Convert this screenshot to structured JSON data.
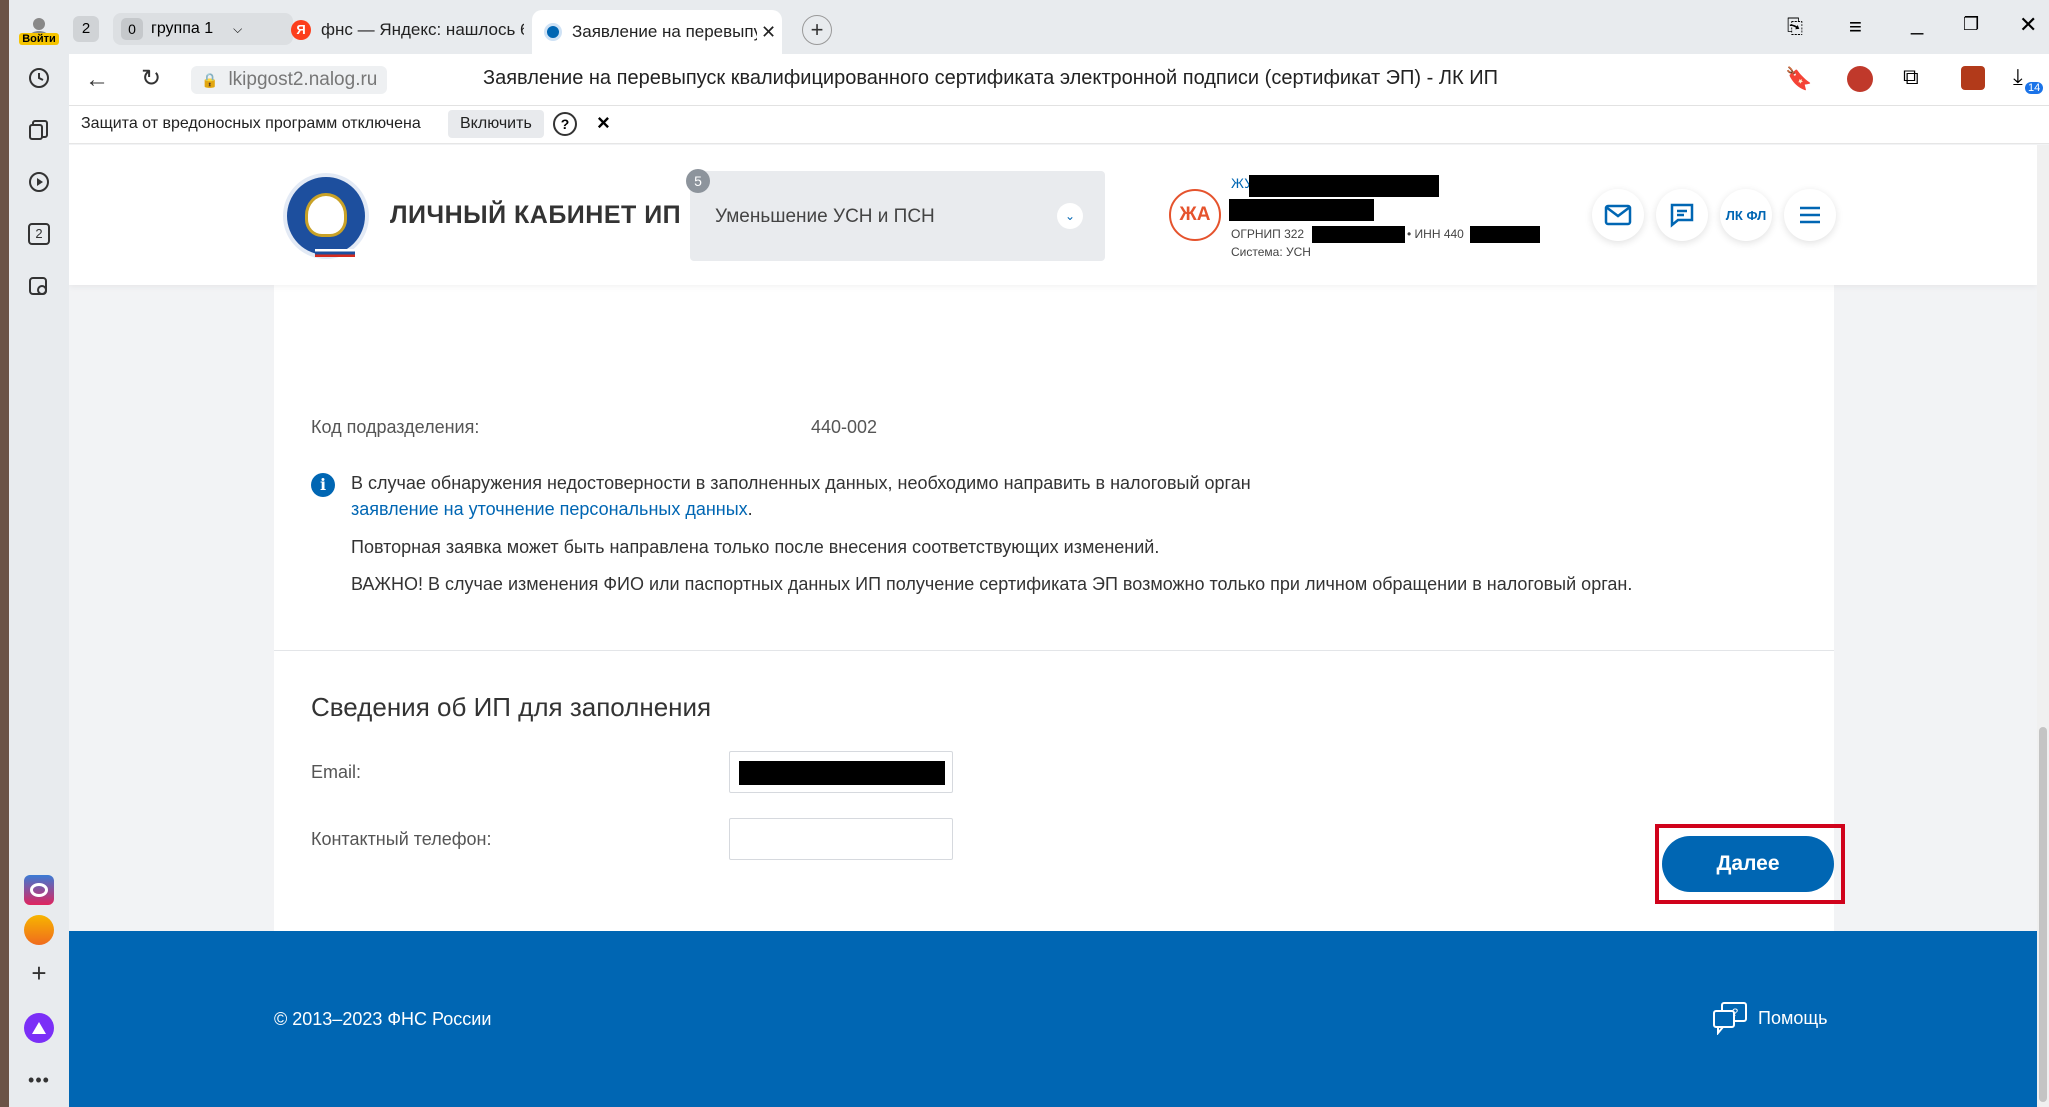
{
  "browser": {
    "login_label": "Войти",
    "tab_count_badge": "2",
    "group_count_badge": "0",
    "group_label": "группа 1",
    "tabs": [
      {
        "label": "фнс — Яндекс: нашлось 6"
      },
      {
        "label": "Заявление на перевыпу"
      }
    ],
    "address": "lkipgost2.nalog.ru",
    "page_title": "Заявление на перевыпуск квалифицированного сертификата электронной подписи (сертификат ЭП) - ЛК ИП",
    "downloads_badge": "14",
    "sidebar_badge": "2",
    "infobar": {
      "text": "Защита от вредоносных программ отключена",
      "enable_button": "Включить",
      "help_icon": "?",
      "close_icon": "×"
    }
  },
  "site": {
    "title": "ЛИЧНЫЙ КАБИНЕТ ИП",
    "task_badge": "5",
    "task_select": "Уменьшение УСН и ПСН",
    "user": {
      "initials": "ЖА",
      "name_prefix": "ЖУ",
      "ogrnip_label": "ОГРНИП 322",
      "inn_label": "• ИНН 440",
      "system": "Система: УСН"
    },
    "lk_fl": "ЛК ФЛ"
  },
  "content": {
    "cut_label": "Код подразделения:",
    "cut_value": "440-002",
    "info_text": "В случае обнаружения недостоверности в заполненных данных, необходимо направить в налоговый орган",
    "info_link": "заявление на уточнение персональных данных",
    "info_link_suffix": ".",
    "note1": "Повторная заявка может быть направлена только после внесения соответствующих изменений.",
    "note2": "ВАЖНО! В случае изменения ФИО или паспортных данных ИП получение сертификата ЭП возможно только при личном обращении в налоговый орган.",
    "section_title": "Сведения об ИП для заполнения",
    "email_label": "Email:",
    "phone_label": "Контактный телефон:",
    "phone_value": ""
  },
  "next_button": "Далее",
  "footer": {
    "copyright": "© 2013–2023 ФНС России",
    "help": "Помощь"
  },
  "colors": {
    "brand_blue": "#0066b3",
    "highlight_red": "#d0021b",
    "avatar_orange": "#e5532d"
  }
}
